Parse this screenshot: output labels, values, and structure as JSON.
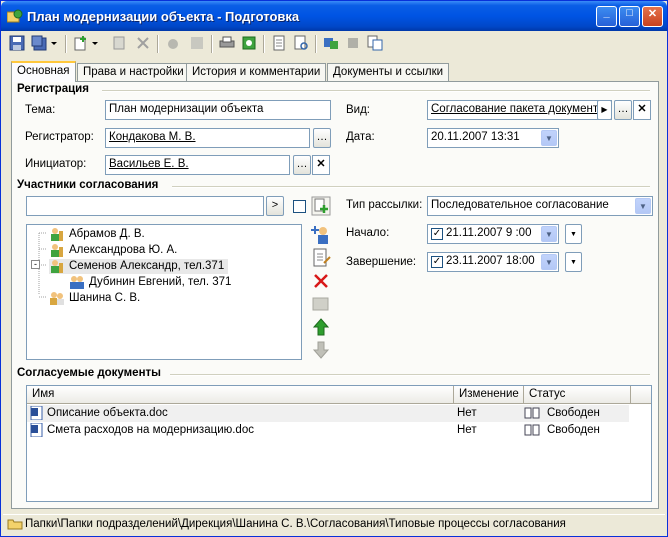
{
  "window": {
    "title": "План модернизации объекта - Подготовка",
    "minimize": "_",
    "maximize": "□",
    "close": "✕"
  },
  "tabs": [
    {
      "label": "Основная",
      "active": true
    },
    {
      "label": "Права и настройки"
    },
    {
      "label": "История и комментарии"
    },
    {
      "label": "Документы и ссылки"
    }
  ],
  "registration": {
    "section_title": "Регистрация",
    "subject_label": "Тема:",
    "subject_value": "План модернизации объекта",
    "registrar_label": "Регистратор:",
    "registrar_value": "Кондакова М. В.",
    "initiator_label": "Инициатор:",
    "initiator_value": "Васильев Е. В.",
    "kind_label": "Вид:",
    "kind_value": "Согласование пакета документо",
    "date_label": "Дата:",
    "date_value": "20.11.2007 13:31"
  },
  "participants": {
    "section_title": "Участники согласования",
    "search_value": "",
    "go_label": ">",
    "tree": [
      {
        "label": "Абрамов Д. В.",
        "level": 0
      },
      {
        "label": "Александрова Ю. А.",
        "level": 0
      },
      {
        "label": "Семенов Александр, тел.371",
        "level": 0,
        "expanded": true,
        "selected": true
      },
      {
        "label": "Дубинин Евгений, тел. 371",
        "level": 1
      },
      {
        "label": "Шанина С. В.",
        "level": 0
      }
    ],
    "mailing_label": "Тип рассылки:",
    "mailing_value": "Последовательное согласование",
    "start_label": "Начало:",
    "start_value": "21.11.2007  9 :00",
    "end_label": "Завершение:",
    "end_value": "23.11.2007 18:00"
  },
  "documents": {
    "section_title": "Согласуемые документы",
    "columns": [
      "Имя",
      "Изменение",
      "Статус"
    ],
    "rows": [
      {
        "name": "Описание объекта.doc",
        "change": "Нет",
        "status": "Свободен"
      },
      {
        "name": "Смета расходов на модернизацию.doc",
        "change": "Нет",
        "status": "Свободен"
      }
    ]
  },
  "statusbar": {
    "path": "Папки\\Папки подразделений\\Дирекция\\Шанина С. В.\\Согласования\\Типовые процессы согласования"
  },
  "colors": {
    "title_bar": "#0054E3",
    "window_bg": "#ECE9D8",
    "delete_red": "#D81818",
    "arrow_green": "#2E9E2E"
  }
}
